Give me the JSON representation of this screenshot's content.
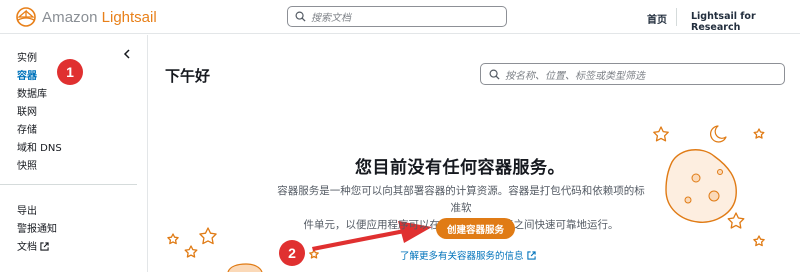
{
  "header": {
    "logo_amazon": "Amazon",
    "logo_product": "Lightsail",
    "search_placeholder": "搜索文档",
    "home_label": "首页",
    "account_label": "Lightsail for Research"
  },
  "sidebar": {
    "items": [
      {
        "label": "实例"
      },
      {
        "label": "容器"
      },
      {
        "label": "数据库"
      },
      {
        "label": "联网"
      },
      {
        "label": "存储"
      },
      {
        "label": "域和 DNS"
      },
      {
        "label": "快照"
      }
    ],
    "active_index": 1,
    "bottom_items": [
      {
        "label": "导出"
      },
      {
        "label": "警报通知"
      },
      {
        "label": "文档"
      }
    ]
  },
  "main": {
    "greeting": "下午好",
    "search_placeholder": "按名称、位置、标签或类型筛选",
    "empty_title": "您目前没有任何容器服务。",
    "empty_desc_line1": "容器服务是一种您可以向其部署容器的计算资源。容器是打包代码和依赖项的标准软",
    "empty_desc_line2": "件单元，以便应用程序可以在不同的计算环境之间快速可靠地运行。",
    "create_button": "创建容器服务",
    "learn_more": "了解更多有关容器服务的信息"
  },
  "annotations": {
    "step1": "1",
    "step2": "2"
  },
  "colors": {
    "accent": "#e07b15",
    "link": "#0073bb",
    "annotation_red": "#e03030"
  }
}
